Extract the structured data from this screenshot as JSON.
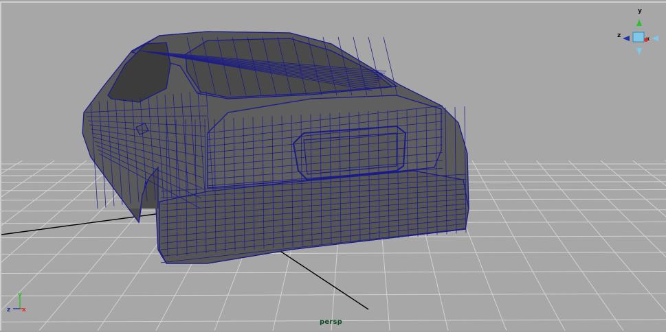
{
  "viewport": {
    "camera_name": "persp"
  },
  "view_cube": {
    "y_label": "y",
    "z_label": "z",
    "x_label": "x"
  },
  "axis_triad": {
    "y_label": "y",
    "z_label": "z",
    "x_label": "x"
  },
  "colors": {
    "background": "#a7a7a7",
    "grid": "#d2d2d2",
    "origin_axis": "#000000",
    "wireframe": "#1a1a8c",
    "mesh_shade": "#5a5a5a",
    "camera_label": "#0b4d25"
  }
}
